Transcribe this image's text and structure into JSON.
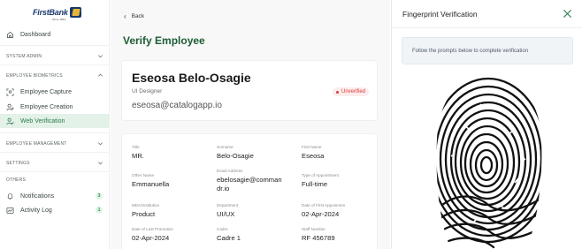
{
  "brand": {
    "logo_text": "FirstBank",
    "logo_sub": "Since 1894"
  },
  "sidebar": {
    "dashboard": "Dashboard",
    "sections": {
      "system_admin": "SYSTEM ADMIN",
      "employee_biometrics": "EMPLOYEE BIOMETRICS",
      "employee_management": "EMPLOYEE MANAGEMENT",
      "settings": "SETTINGS",
      "others": "OTHERS"
    },
    "items": [
      {
        "label": "Employee Capture",
        "icon": "face-scan-icon"
      },
      {
        "label": "Employee Creation",
        "icon": "user-add-icon"
      },
      {
        "label": "Web Verification",
        "icon": "user-check-icon",
        "active": true
      }
    ],
    "others": [
      {
        "label": "Notifications",
        "icon": "bell-icon",
        "count": "3"
      },
      {
        "label": "Activity Log",
        "icon": "activity-icon",
        "count": "1"
      }
    ]
  },
  "main": {
    "back_label": "Back",
    "page_title": "Verify Employee",
    "employee": {
      "name": "Eseosa Belo-Osagie",
      "role": "UI Designer",
      "email": "eseosa@catalogapp.io",
      "status": "Unverified"
    },
    "details": [
      {
        "label": "Title",
        "value": "MR."
      },
      {
        "label": "Surname",
        "value": "Belo-Osagie"
      },
      {
        "label": "First Name",
        "value": "Eseosa"
      },
      {
        "label": "Other Name",
        "value": "Emmanuella"
      },
      {
        "label": "Email Address",
        "value": "ebelosagie@comman dr.io"
      },
      {
        "label": "Type of Appointment",
        "value": "Full-time"
      },
      {
        "label": "MDA/Institution",
        "value": "Product"
      },
      {
        "label": "Department",
        "value": "UI/UX"
      },
      {
        "label": "Date of First Appoinmen",
        "value": "02-Apr-2024"
      },
      {
        "label": "Date of Last Promotion",
        "value": "02-Apr-2024"
      },
      {
        "label": "Cadre",
        "value": "Cadre 1"
      },
      {
        "label": "Staff Number",
        "value": "RF 456789"
      }
    ]
  },
  "panel": {
    "title": "Fingerprint Verification",
    "info": "Follow the prompts below to complete verification"
  },
  "colors": {
    "accent": "#1d5c35",
    "active_bg": "#e3f1e8",
    "danger": "#d83a3a"
  }
}
